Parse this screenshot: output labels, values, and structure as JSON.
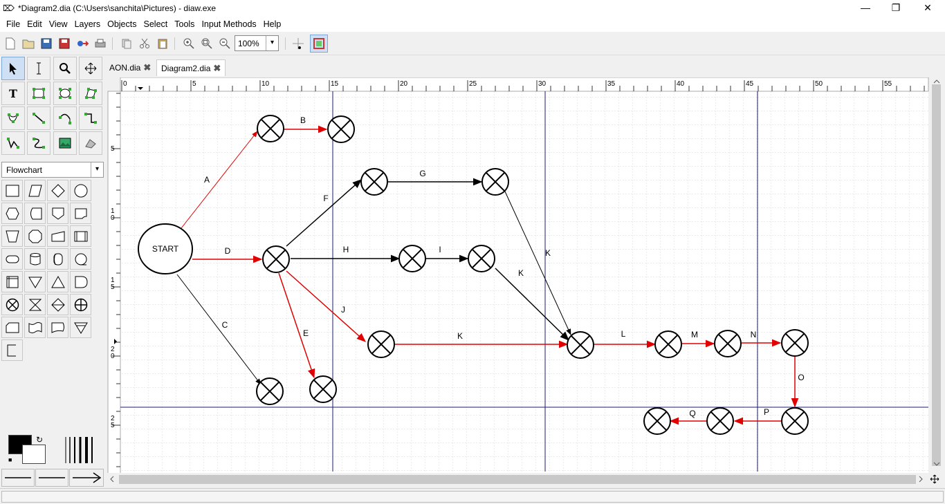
{
  "window": {
    "title": "*Diagram2.dia (C:\\Users\\sanchita\\Pictures) - diaw.exe",
    "controls": [
      "—",
      "❐",
      "✕"
    ]
  },
  "menu": [
    "File",
    "Edit",
    "View",
    "Layers",
    "Objects",
    "Select",
    "Tools",
    "Input Methods",
    "Help"
  ],
  "toolbar": {
    "zoom_value": "100%",
    "buttons": [
      "new",
      "open",
      "save",
      "save-as",
      "export",
      "print",
      "copy",
      "cut",
      "paste",
      "zoom-in",
      "zoom-fit",
      "zoom-out",
      "snap-to-grid",
      "snap-to-objects"
    ]
  },
  "tabs": [
    {
      "label": "AON.dia",
      "active": false
    },
    {
      "label": "Diagram2.dia",
      "active": true
    }
  ],
  "toolbox": {
    "sheet_selector": "Flowchart"
  },
  "ruler": {
    "h_labels": [
      "0",
      "5",
      "10",
      "15",
      "20",
      "25",
      "30",
      "35",
      "40",
      "45",
      "50",
      "55"
    ],
    "v_labels": [
      "5",
      "1\n0",
      "1\n5",
      "2\n0",
      "2\n5"
    ]
  },
  "diagram": {
    "start_label": "START",
    "edge_labels": {
      "A": "A",
      "B": "B",
      "C": "C",
      "D": "D",
      "E": "E",
      "F": "F",
      "G": "G",
      "H": "H",
      "I": "I",
      "J": "J",
      "K1": "K",
      "K2": "K",
      "K3": "K",
      "L": "L",
      "M": "M",
      "N": "N",
      "O": "O",
      "P": "P",
      "Q": "Q"
    }
  },
  "colors": {
    "critical_path": "#e00000",
    "normal_path": "#000000",
    "page_break": "#1a1a6e",
    "grid": "#c8c8c8"
  }
}
